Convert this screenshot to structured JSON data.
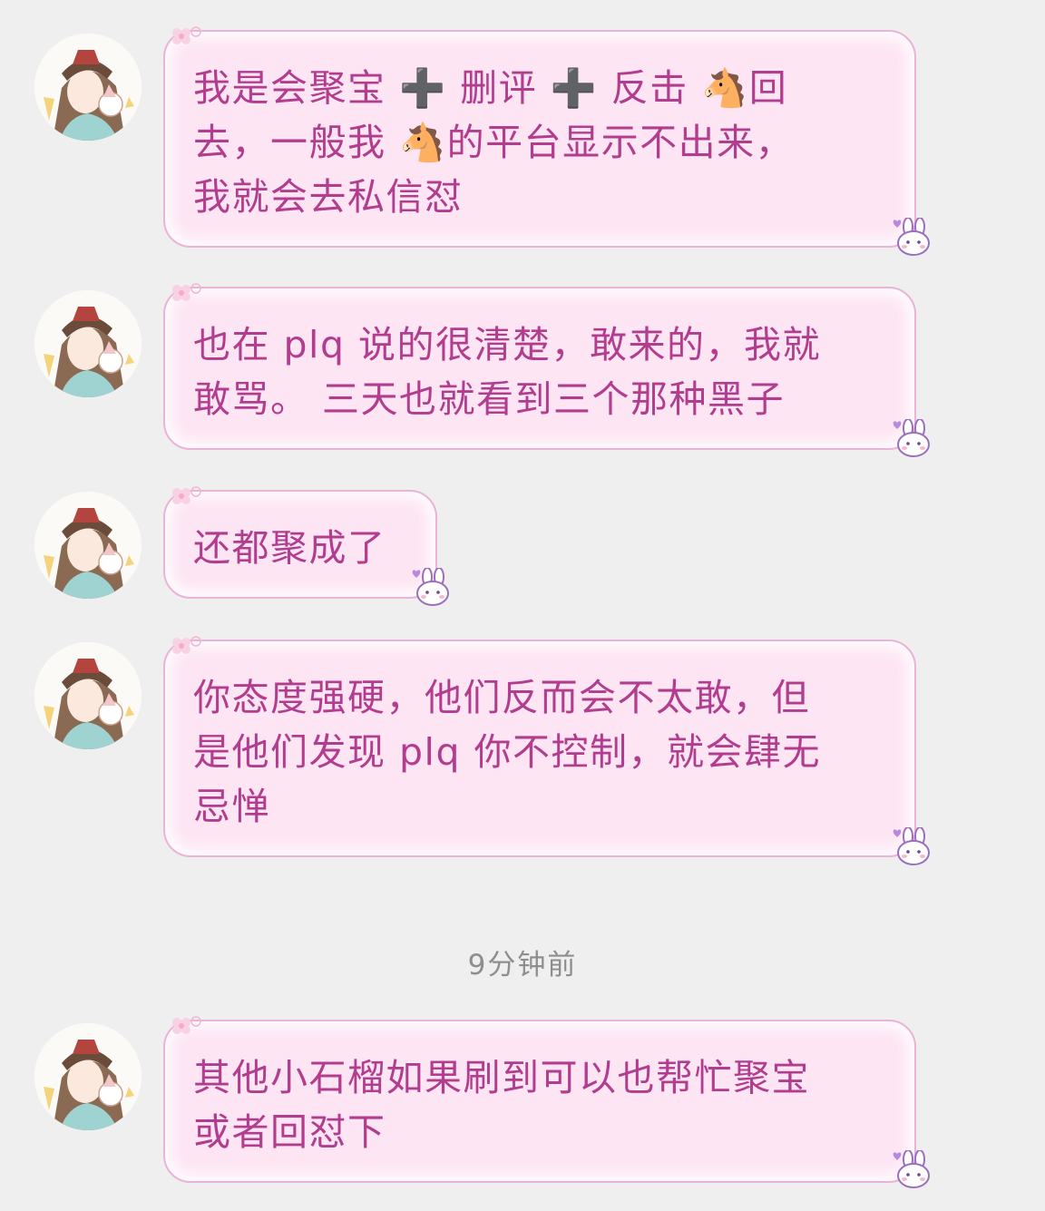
{
  "messages": [
    {
      "text": "我是会聚宝 ➕ 删评 ➕ 反击 🐴回\n去，一般我 🐴的平台显示不出来，\n我就会去私信怼"
    },
    {
      "text": "也在 plq 说的很清楚，敢来的，我就\n敢骂。 三天也就看到三个那种黑子"
    },
    {
      "text": "还都聚成了"
    },
    {
      "text": "你态度强硬，他们反而会不太敢，但\n是他们发现 plq 你不控制，就会肆无\n忌惮"
    },
    {
      "text": "其他小石榴如果刷到可以也帮忙聚宝\n或者回怼下"
    }
  ],
  "timestamp": "9分钟前",
  "icons": {
    "avatar": "anime-avatar-icon",
    "flower": "flower-sticker-icon",
    "bunny": "bunny-sticker-icon"
  },
  "colors": {
    "background": "#efefef",
    "bubble_fill": "#fde5f3",
    "bubble_border": "#eab3d7",
    "message_text": "#b23d8e",
    "timestamp_text": "#8e8e8e"
  }
}
